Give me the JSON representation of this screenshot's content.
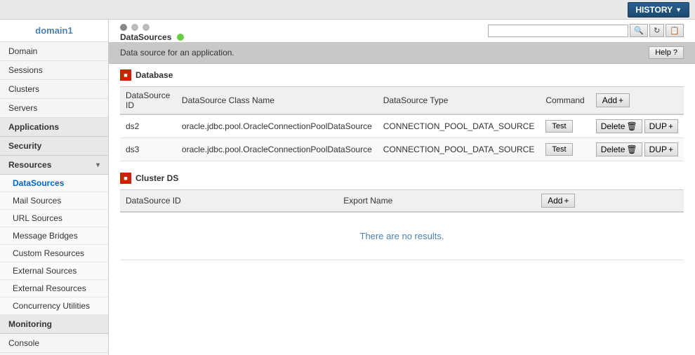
{
  "topbar": {
    "history_label": "HISTORY",
    "history_arrow": "▼"
  },
  "sidebar": {
    "domain_label": "domain1",
    "items": [
      {
        "label": "Domain",
        "key": "domain"
      },
      {
        "label": "Sessions",
        "key": "sessions"
      },
      {
        "label": "Clusters",
        "key": "clusters"
      },
      {
        "label": "Servers",
        "key": "servers"
      }
    ],
    "section_applications": "Applications",
    "section_security": "Security",
    "section_resources": "Resources",
    "section_resources_arrow": "▾",
    "sub_items": [
      {
        "label": "DataSources",
        "key": "datasources",
        "active": true
      },
      {
        "label": "Mail Sources",
        "key": "mail-sources"
      },
      {
        "label": "URL Sources",
        "key": "url-sources"
      },
      {
        "label": "Message Bridges",
        "key": "message-bridges"
      },
      {
        "label": "Custom Resources",
        "key": "custom-resources"
      },
      {
        "label": "External Sources",
        "key": "external-sources"
      },
      {
        "label": "External Resources",
        "key": "external-resources"
      },
      {
        "label": "Concurrency Utilities",
        "key": "concurrency-utilities"
      }
    ],
    "section_monitoring": "Monitoring",
    "console_label": "Console"
  },
  "main": {
    "title": "DataSources",
    "info_text": "Data source for an application.",
    "help_label": "Help ?",
    "search_placeholder": "",
    "nav_dots": [
      {
        "active": true
      },
      {
        "active": false
      },
      {
        "active": false
      }
    ]
  },
  "database_section": {
    "title": "Database",
    "icon": "🔷",
    "add_label": "Add",
    "add_icon": "+",
    "columns": [
      "DataSource ID",
      "DataSource Class Name",
      "DataSource Type",
      "Command"
    ],
    "rows": [
      {
        "id": "ds2",
        "class_name": "oracle.jdbc.pool.OracleConnectionPoolDataSource",
        "type": "CONNECTION_POOL_DATA_SOURCE",
        "test_label": "Test",
        "delete_label": "Delete",
        "dup_label": "DUP"
      },
      {
        "id": "ds3",
        "class_name": "oracle.jdbc.pool.OracleConnectionPoolDataSource",
        "type": "CONNECTION_POOL_DATA_SOURCE",
        "test_label": "Test",
        "delete_label": "Delete",
        "dup_label": "DUP"
      }
    ]
  },
  "clusterds_section": {
    "title": "Cluster DS",
    "add_label": "Add",
    "add_icon": "+",
    "columns": [
      "DataSource ID",
      "Export Name"
    ],
    "no_results": "There are no results."
  }
}
